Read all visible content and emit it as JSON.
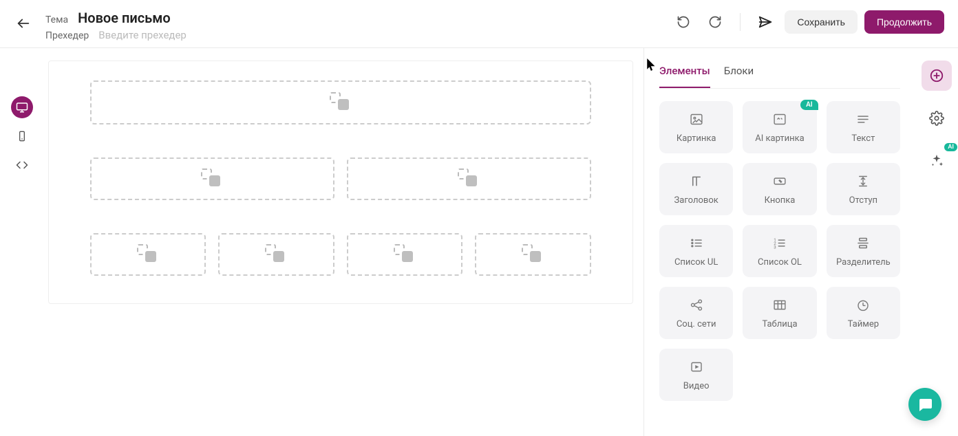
{
  "header": {
    "subject_label": "Тема",
    "subject_value": "Новое письмо",
    "preheader_label": "Прехедер",
    "preheader_placeholder": "Введите прехедер",
    "save_label": "Сохранить",
    "continue_label": "Продолжить"
  },
  "sidebar": {
    "tabs": {
      "elements": "Элементы",
      "blocks": "Блоки"
    },
    "elements": {
      "image": "Картинка",
      "ai_image": "AI картинка",
      "text": "Текст",
      "heading": "Заголовок",
      "button": "Кнопка",
      "spacer": "Отступ",
      "list_ul": "Список UL",
      "list_ol": "Список OL",
      "divider": "Разделитель",
      "social": "Соц. сети",
      "table": "Таблица",
      "timer": "Таймер",
      "video": "Видео"
    },
    "ai_badge": "AI"
  },
  "right_rail": {
    "ai_label": "AI"
  }
}
